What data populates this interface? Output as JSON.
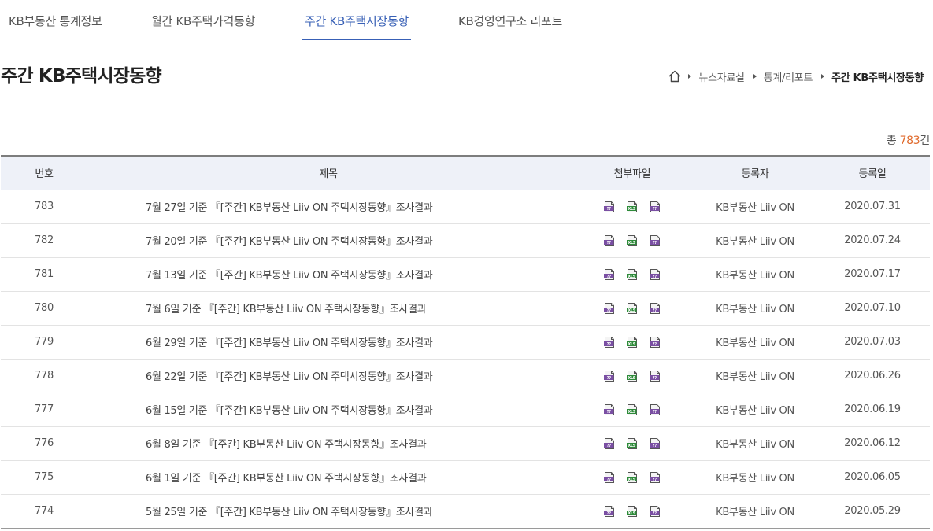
{
  "tabs": [
    {
      "label": "KB부동산 통계정보"
    },
    {
      "label": "월간 KB주택가격동향"
    },
    {
      "label": "주간 KB주택시장동향"
    },
    {
      "label": "KB경영연구소 리포트"
    }
  ],
  "page": {
    "title": "주간 KB주택시장동향"
  },
  "breadcrumb": {
    "items": [
      "뉴스자료실",
      "통계/리포트"
    ],
    "current": "주간 KB주택시장동향"
  },
  "total": {
    "prefix": "총 ",
    "count": "783",
    "suffix": "건"
  },
  "table": {
    "headers": [
      "번호",
      "제목",
      "첨부파일",
      "등록자",
      "등록일"
    ],
    "rows": [
      {
        "no": "783",
        "title": "7월 27일 기준 『[주간] KB부동산 Liiv ON 주택시장동향』조사결과",
        "author": "KB부동산 Liiv ON",
        "date": "2020.07.31"
      },
      {
        "no": "782",
        "title": "7월 20일 기준 『[주간] KB부동산 Liiv ON 주택시장동향』조사결과",
        "author": "KB부동산 Liiv ON",
        "date": "2020.07.24"
      },
      {
        "no": "781",
        "title": "7월 13일 기준 『[주간] KB부동산 Liiv ON 주택시장동향』조사결과",
        "author": "KB부동산 Liiv ON",
        "date": "2020.07.17"
      },
      {
        "no": "780",
        "title": "7월 6일 기준 『[주간] KB부동산 Liiv ON 주택시장동향』조사결과",
        "author": "KB부동산 Liiv ON",
        "date": "2020.07.10"
      },
      {
        "no": "779",
        "title": "6월 29일 기준 『[주간] KB부동산 Liiv ON 주택시장동향』조사결과",
        "author": "KB부동산 Liiv ON",
        "date": "2020.07.03"
      },
      {
        "no": "778",
        "title": "6월 22일 기준 『[주간] KB부동산 Liiv ON 주택시장동향』조사결과",
        "author": "KB부동산 Liiv ON",
        "date": "2020.06.26"
      },
      {
        "no": "777",
        "title": "6월 15일 기준 『[주간] KB부동산 Liiv ON 주택시장동향』조사결과",
        "author": "KB부동산 Liiv ON",
        "date": "2020.06.19"
      },
      {
        "no": "776",
        "title": "6월 8일 기준 『[주간] KB부동산 Liiv ON 주택시장동향』조사결과",
        "author": "KB부동산 Liiv ON",
        "date": "2020.06.12"
      },
      {
        "no": "775",
        "title": "6월 1일 기준 『[주간] KB부동산 Liiv ON 주택시장동향』조사결과",
        "author": "KB부동산 Liiv ON",
        "date": "2020.06.05"
      },
      {
        "no": "774",
        "title": "5월 25일 기준 『[주간] KB부동산 Liiv ON 주택시장동향』조사결과",
        "author": "KB부동산 Liiv ON",
        "date": "2020.05.29"
      }
    ]
  },
  "attachments": [
    {
      "icon": "hwp-file-icon",
      "label": "??",
      "color": "#7a4fa3"
    },
    {
      "icon": "xls-file-icon",
      "label": "XLS",
      "color": "#2e8b3a"
    },
    {
      "icon": "pdf-file-icon",
      "label": "??",
      "color": "#7a4fa3"
    }
  ],
  "colors": {
    "accent": "#3860b6",
    "count": "#e06a2c",
    "header_bg": "#eef1f8"
  }
}
